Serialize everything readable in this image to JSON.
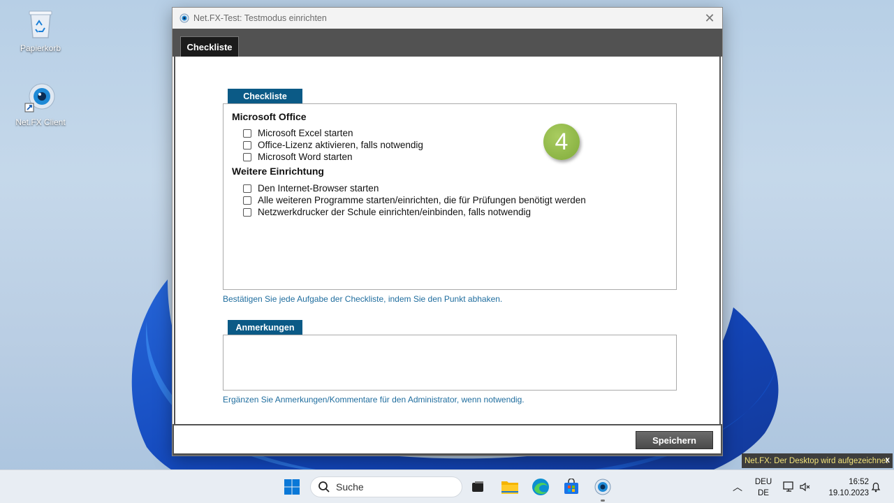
{
  "desktop": {
    "icons": [
      {
        "label": "Papierkorb",
        "icon": "recycle-bin-icon"
      },
      {
        "label": "Net.FX Client",
        "icon": "netfx-client-icon"
      }
    ]
  },
  "window": {
    "title": "Net.FX-Test: Testmodus einrichten",
    "tabs": [
      {
        "label": "Checkliste",
        "active": true
      }
    ],
    "checklist": {
      "section_label": "Checkliste",
      "groups": [
        {
          "title": "Microsoft Office",
          "items": [
            {
              "label": "Microsoft Excel starten",
              "checked": false
            },
            {
              "label": "Office-Lizenz aktivieren, falls notwendig",
              "checked": false
            },
            {
              "label": "Microsoft Word starten",
              "checked": false
            }
          ]
        },
        {
          "title": "Weitere Einrichtung",
          "items": [
            {
              "label": "Den Internet-Browser starten",
              "checked": false
            },
            {
              "label": "Alle weiteren Programme starten/einrichten, die für Prüfungen benötigt werden",
              "checked": false
            },
            {
              "label": "Netzwerkdrucker der Schule einrichten/einbinden, falls notwendig",
              "checked": false
            }
          ]
        }
      ],
      "hint": "Bestätigen Sie jede Aufgabe der Checkliste, indem Sie den Punkt abhaken."
    },
    "step_badge": "4",
    "notes": {
      "section_label": "Anmerkungen",
      "value": "",
      "hint": "Ergänzen Sie Anmerkungen/Kommentare für den Administrator, wenn notwendig."
    },
    "save_label": "Speichern"
  },
  "toast": {
    "text": "Net.FX: Der Desktop wird aufgezeichnet",
    "close": "x"
  },
  "taskbar": {
    "search_placeholder": "Suche",
    "language": "DEU",
    "layout": "DE",
    "time": "16:52",
    "date": "19.10.2023"
  },
  "colors": {
    "accent": "#0b5a86",
    "hint": "#1f6d9e",
    "badge": "#8cb748",
    "tabbar": "#525252"
  }
}
